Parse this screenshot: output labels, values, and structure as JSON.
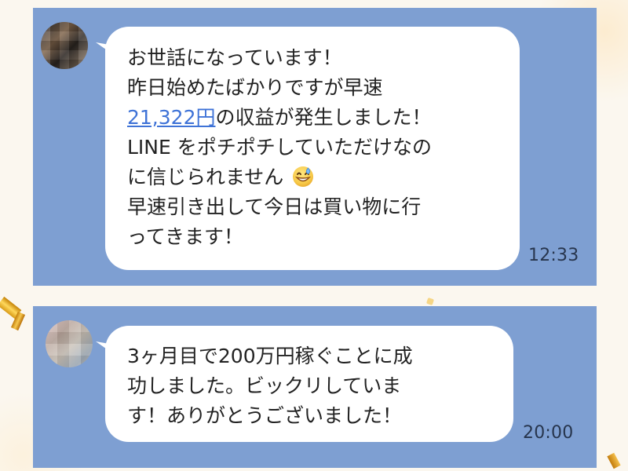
{
  "chat": {
    "messages": [
      {
        "time": "12:33",
        "lines": [
          {
            "text": "お世話になっています！"
          },
          {
            "text": "昨日始めたばかりですが早速"
          },
          {
            "link_text": "21,322円",
            "after": "の収益が発生しました！"
          },
          {
            "text": "LINE をポチポチしていただけなの"
          },
          {
            "text": "に信じられません"
          },
          {
            "text": "早速引き出して今日は買い物に行"
          },
          {
            "text": "ってきます！"
          }
        ],
        "emoji_icon": "grinning-sweat-emoji"
      },
      {
        "time": "20:00",
        "lines": [
          {
            "text": "3ヶ月目で200万円稼ぐことに成"
          },
          {
            "text": "功しました。ビックリしていま"
          },
          {
            "text": "す！ありがとうございました！"
          }
        ]
      }
    ]
  },
  "colors": {
    "chat_background": "#7e9fd2",
    "bubble": "#ffffff",
    "link": "#3f73d7",
    "text": "#222222",
    "timestamp": "#27354d"
  },
  "icons": {
    "avatar_1": "blurred-avatar",
    "avatar_2": "blurred-avatar",
    "emoji": "grinning-sweat-emoji",
    "decor": "gold-confetti"
  }
}
